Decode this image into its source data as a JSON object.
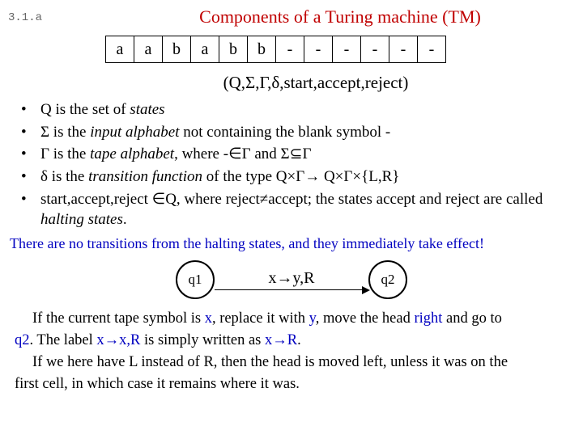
{
  "slide_ref": "3.1.a",
  "title": "Components of a Turing machine (TM)",
  "tape_cells": [
    "a",
    "a",
    "b",
    "a",
    "b",
    "b",
    "-",
    "-",
    "-",
    "-",
    "-",
    "-"
  ],
  "tuple_html": "(Q,Σ,Γ,δ,start,accept,reject)",
  "bullets": [
    {
      "html": "Q is the set of <i>states</i>"
    },
    {
      "html": "Σ is the <i>input alphabet</i> not containing the blank symbol -"
    },
    {
      "html": "Γ is the <i>tape alphabet</i>, where  -∈Γ  and  Σ⊆Γ"
    },
    {
      "html": "δ is the <i>transition function</i> of the type Q×Γ→ Q×Γ×{L,R}"
    },
    {
      "html": "start,accept,reject ∈Q,  where  reject≠accept; the states accept and reject are called <i>halting states</i>."
    }
  ],
  "halt_note": "There are no transitions from the halting states, and they immediately take effect!",
  "diagram": {
    "q1": "q1",
    "label": "x→y,R",
    "q2": "q2"
  },
  "explain": [
    {
      "html": "If the current tape symbol is <span class='blue'>x</span>, replace it with <span class='blue'>y</span>,  move the head <span class='blue'>right</span> and go to"
    },
    {
      "html_noindent": "<span class='blue'>q2</span>.  The label <span class='blue'>x→x,R</span> is simply written as <span class='blue'>x→R</span>."
    },
    {
      "html": "If we here have L instead of R, then the head is moved left, unless it was on the"
    },
    {
      "html_noindent": "first cell, in which case it remains where it was."
    }
  ]
}
